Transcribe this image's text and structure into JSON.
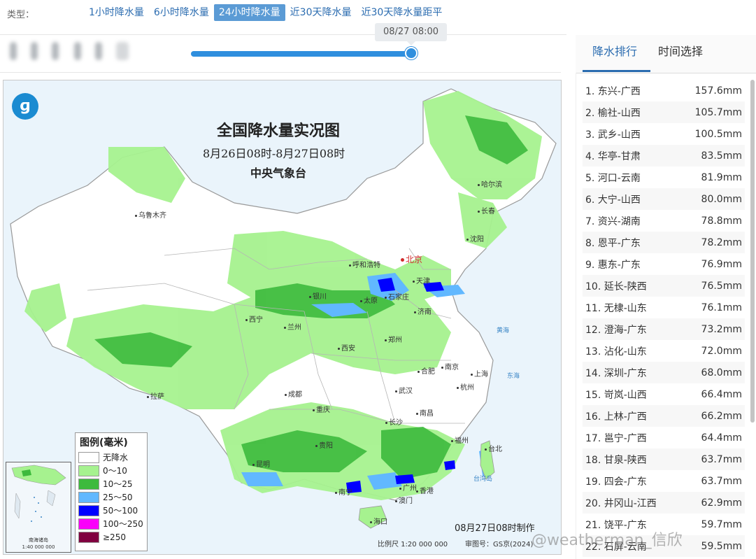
{
  "type_bar": {
    "label": "类型：",
    "tabs": [
      {
        "label": "1小时降水量",
        "active": false
      },
      {
        "label": "6小时降水量",
        "active": false
      },
      {
        "label": "24小时降水量",
        "active": true
      },
      {
        "label": "近30天降水量",
        "active": false
      },
      {
        "label": "近30天降水量距平",
        "active": false
      }
    ]
  },
  "time_slider": {
    "tooltip": "08/27 08:00",
    "progress": 1.0
  },
  "map": {
    "title": "全国降水量实况图",
    "subtitle": "8月26日08时-8月27日08时",
    "org": "中央气象台",
    "cities": [
      {
        "name": "乌鲁木齐"
      },
      {
        "name": "哈尔滨"
      },
      {
        "name": "长春"
      },
      {
        "name": "沈阳"
      },
      {
        "name": "呼和浩特"
      },
      {
        "name": "北京",
        "capital": true
      },
      {
        "name": "天津"
      },
      {
        "name": "银川"
      },
      {
        "name": "太原"
      },
      {
        "name": "石家庄"
      },
      {
        "name": "济南"
      },
      {
        "name": "西宁"
      },
      {
        "name": "兰州"
      },
      {
        "name": "郑州"
      },
      {
        "name": "西安"
      },
      {
        "name": "合肥"
      },
      {
        "name": "南京"
      },
      {
        "name": "上海"
      },
      {
        "name": "杭州"
      },
      {
        "name": "拉萨"
      },
      {
        "name": "成都"
      },
      {
        "name": "武汉"
      },
      {
        "name": "重庆"
      },
      {
        "name": "南昌"
      },
      {
        "name": "长沙"
      },
      {
        "name": "福州"
      },
      {
        "name": "台北"
      },
      {
        "name": "贵阳"
      },
      {
        "name": "昆明"
      },
      {
        "name": "南宁"
      },
      {
        "name": "广州"
      },
      {
        "name": "香港"
      },
      {
        "name": "澳门"
      },
      {
        "name": "海口"
      }
    ],
    "seas": [
      "黄海",
      "东海",
      "台湾岛"
    ],
    "legend": {
      "title": "图例(毫米)",
      "items": [
        {
          "label": "无降水",
          "color": "#ffffff"
        },
        {
          "label": "0～10",
          "color": "#a6f28f"
        },
        {
          "label": "10～25",
          "color": "#3dba3d"
        },
        {
          "label": "25～50",
          "color": "#61b8ff"
        },
        {
          "label": "50～100",
          "color": "#0000ff"
        },
        {
          "label": "100～250",
          "color": "#fa00fa"
        },
        {
          "label": "≥250",
          "color": "#800040"
        }
      ]
    },
    "inset": {
      "label": "南海诸岛",
      "scale": "1:40 000 000"
    },
    "made_time": "08月27日08时制作",
    "scale": "比例尺 1:20 000 000",
    "review": "审图号：GS京(2024)"
  },
  "side_panel": {
    "tabs": [
      {
        "label": "降水排行",
        "active": true
      },
      {
        "label": "时间选择",
        "active": false
      }
    ],
    "ranking": [
      {
        "name": "1. 东兴-广西",
        "value": "157.6mm"
      },
      {
        "name": "2. 榆社-山西",
        "value": "105.7mm"
      },
      {
        "name": "3. 武乡-山西",
        "value": "100.5mm"
      },
      {
        "name": "4. 华亭-甘肃",
        "value": "83.5mm"
      },
      {
        "name": "5. 河口-云南",
        "value": "81.9mm"
      },
      {
        "name": "6. 大宁-山西",
        "value": "80.0mm"
      },
      {
        "name": "7. 资兴-湖南",
        "value": "78.8mm"
      },
      {
        "name": "8. 恩平-广东",
        "value": "78.2mm"
      },
      {
        "name": "9. 惠东-广东",
        "value": "76.9mm"
      },
      {
        "name": "10. 延长-陕西",
        "value": "76.5mm"
      },
      {
        "name": "11. 无棣-山东",
        "value": "76.1mm"
      },
      {
        "name": "12. 澄海-广东",
        "value": "73.2mm"
      },
      {
        "name": "13. 沾化-山东",
        "value": "72.0mm"
      },
      {
        "name": "14. 深圳-广东",
        "value": "68.0mm"
      },
      {
        "name": "15. 岢岚-山西",
        "value": "66.4mm"
      },
      {
        "name": "16. 上林-广西",
        "value": "66.2mm"
      },
      {
        "name": "17. 邕宁-广西",
        "value": "64.4mm"
      },
      {
        "name": "18. 甘泉-陕西",
        "value": "63.7mm"
      },
      {
        "name": "19. 四会-广东",
        "value": "63.7mm"
      },
      {
        "name": "20. 井冈山-江西",
        "value": "62.9mm"
      },
      {
        "name": "21. 饶平-广东",
        "value": "59.7mm"
      },
      {
        "name": "22. 石屏-云南",
        "value": "59.5mm"
      }
    ]
  },
  "watermark": "@weatherman_信欣",
  "colors": {
    "accent": "#2b6cb0",
    "slider": "#2f8fde",
    "active_tab_bg": "#5b9bd5"
  }
}
